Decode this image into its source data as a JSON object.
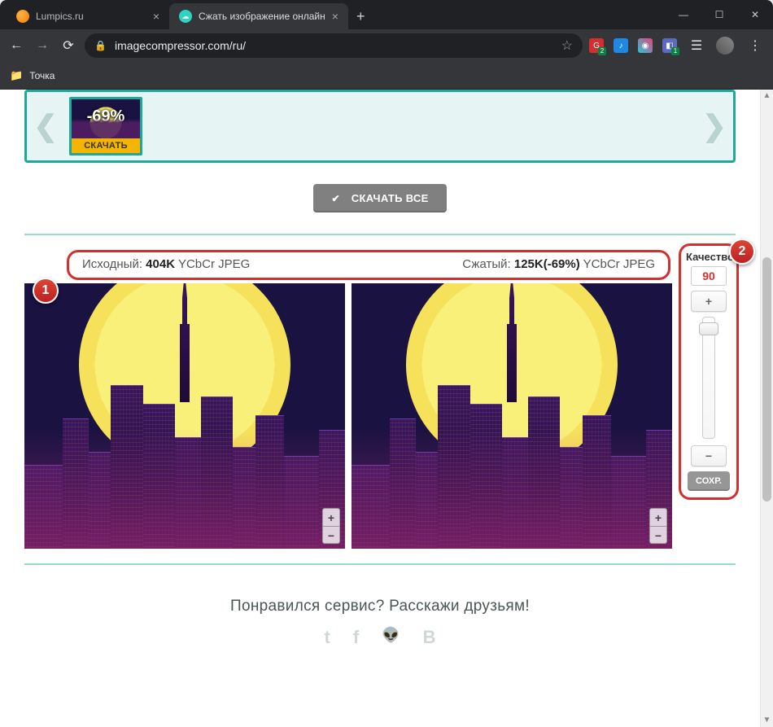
{
  "tabs": [
    {
      "title": "Lumpics.ru",
      "favicon": "orange",
      "active": false
    },
    {
      "title": "Сжать изображение онлайн",
      "favicon": "cyan",
      "active": true
    }
  ],
  "address": {
    "url": "imagecompressor.com/ru/",
    "secure_icon": "lock-icon"
  },
  "extensions": {
    "badge1": "2",
    "badge2": "1"
  },
  "bookmarks": {
    "item1": "Точка"
  },
  "thumbnail": {
    "percent_badge": "-69%",
    "download_label": "СКАЧАТЬ"
  },
  "download_all_label": "СКАЧАТЬ ВСЕ",
  "info": {
    "original_label": "Исходный:",
    "original_size": "404K",
    "original_meta": "YCbCr JPEG",
    "compressed_label": "Сжатый:",
    "compressed_size": "125K(-69%)",
    "compressed_meta": "YCbCr JPEG"
  },
  "callouts": {
    "one": "1",
    "two": "2"
  },
  "quality": {
    "label": "Качество",
    "value": "90",
    "plus": "+",
    "minus": "−",
    "save": "СОХР."
  },
  "zoom": {
    "in": "+",
    "out": "−"
  },
  "like": {
    "heading": "Понравился сервис? Расскажи друзьям!",
    "socials": [
      "t",
      "f",
      "👽",
      "B"
    ]
  }
}
